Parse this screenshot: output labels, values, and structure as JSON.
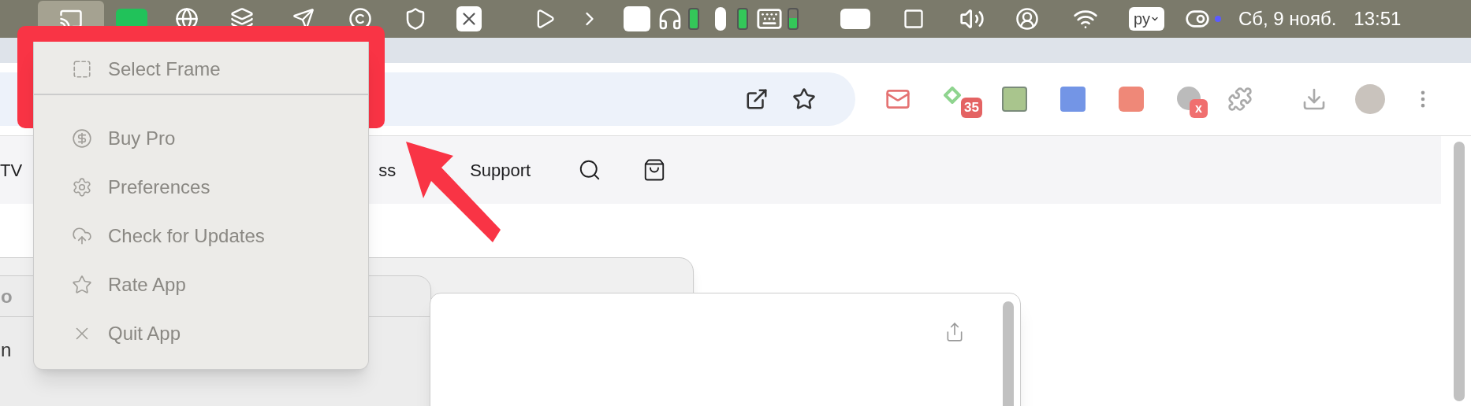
{
  "menu_bar": {
    "input_source": "ру",
    "date": "Сб, 9 нояб.",
    "time": "13:51"
  },
  "browser": {
    "extension_badges": [
      "35",
      "x"
    ],
    "nav": [
      {
        "label": "TV"
      },
      {
        "label": "ss"
      },
      {
        "label": "Support"
      }
    ]
  },
  "back_windows": [
    {
      "title": "o",
      "text": "n"
    }
  ],
  "menu": {
    "items": [
      {
        "label": "Select Frame",
        "kind": "frame",
        "separator_after": true
      },
      {
        "label": "Buy Pro",
        "kind": "dollar",
        "separator_after": false
      },
      {
        "label": "Preferences",
        "kind": "gear",
        "separator_after": false
      },
      {
        "label": "Check for Updates",
        "kind": "cloud",
        "separator_after": false
      },
      {
        "label": "Rate App",
        "kind": "star",
        "separator_after": false
      },
      {
        "label": "Quit App",
        "kind": "quit",
        "separator_after": false
      }
    ]
  }
}
